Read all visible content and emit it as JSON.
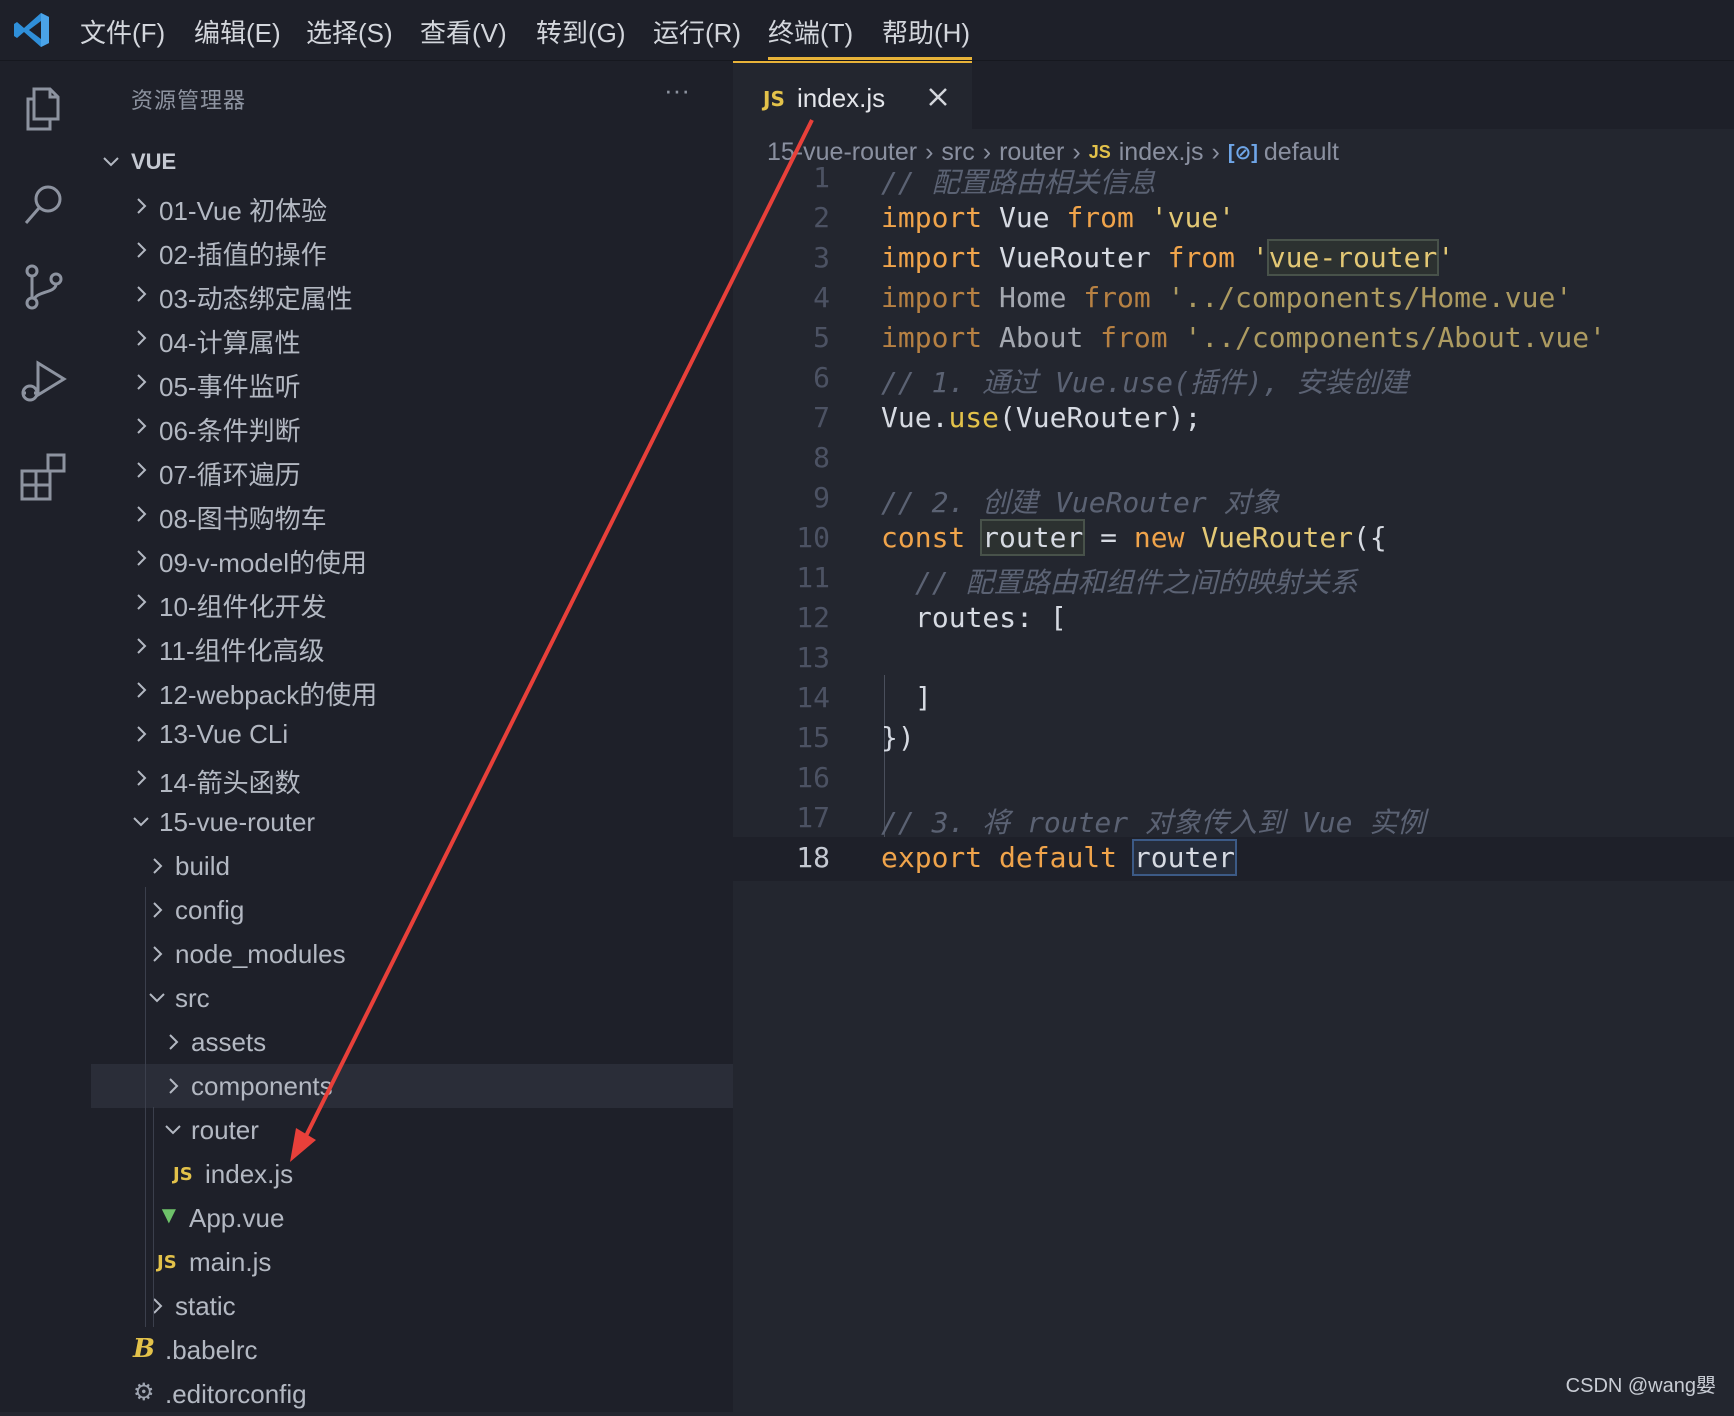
{
  "menubar": {
    "items": [
      "文件(F)",
      "编辑(E)",
      "选择(S)",
      "查看(V)",
      "转到(G)",
      "运行(R)",
      "终端(T)",
      "帮助(H)"
    ]
  },
  "sidebar": {
    "title": "资源管理器",
    "more": "···",
    "root": "VUE",
    "items": [
      "01-Vue 初体验",
      "02-插值的操作",
      "03-动态绑定属性",
      "04-计算属性",
      "05-事件监听",
      "06-条件判断",
      "07-循环遍历",
      "08-图书购物车",
      "09-v-model的使用",
      "10-组件化开发",
      "11-组件化高级",
      "12-webpack的使用",
      "13-Vue CLi",
      "14-箭头函数",
      "15-vue-router",
      "build",
      "config",
      "node_modules",
      "src",
      "assets",
      "components",
      "router",
      "index.js",
      "App.vue",
      "main.js",
      "static",
      ".babelrc",
      ".editorconfig"
    ]
  },
  "tab": {
    "badge": "JS",
    "label": "index.js"
  },
  "breadcrumb": {
    "parts": [
      "15-vue-router",
      "src",
      "router",
      "index.js",
      "default"
    ],
    "js_badge": "JS",
    "symbol_icon": "[⊘]"
  },
  "code": {
    "line_numbers": [
      "1",
      "2",
      "3",
      "4",
      "5",
      "6",
      "7",
      "8",
      "9",
      "10",
      "11",
      "12",
      "13",
      "14",
      "15",
      "16",
      "17",
      "18"
    ],
    "l1": "// 配置路由相关信息",
    "l2": [
      "import",
      " Vue ",
      "from",
      " 'vue'"
    ],
    "l3": [
      "import",
      " VueRouter ",
      "from",
      " '",
      "vue-router",
      "'"
    ],
    "l4": [
      "import",
      " Home ",
      "from",
      " '../components/Home.vue'"
    ],
    "l5": [
      "import",
      " About ",
      "from",
      " '../components/About.vue'"
    ],
    "l6": "// 1. 通过 Vue.use(插件), 安装创建",
    "l7": [
      "Vue",
      ".",
      "use",
      "(VueRouter);"
    ],
    "l9": "// 2. 创建 VueRouter 对象",
    "l10": [
      "const",
      " ",
      "router",
      " = ",
      "new",
      " ",
      "VueRouter",
      "({"
    ],
    "l11": "// 配置路由和组件之间的映射关系",
    "l12": "routes: [",
    "l14": "]",
    "l15": "})",
    "l17": "// 3. 将 router 对象传入到 Vue 实例",
    "l18": [
      "export",
      " ",
      "default",
      " ",
      "router"
    ]
  },
  "watermark": "CSDN @wang嬰",
  "colors": {
    "accent": "#e8b339",
    "arrow": "#e8403a",
    "keyword": "#f0a44b",
    "string": "#e3c875",
    "comment": "#5b6273"
  }
}
